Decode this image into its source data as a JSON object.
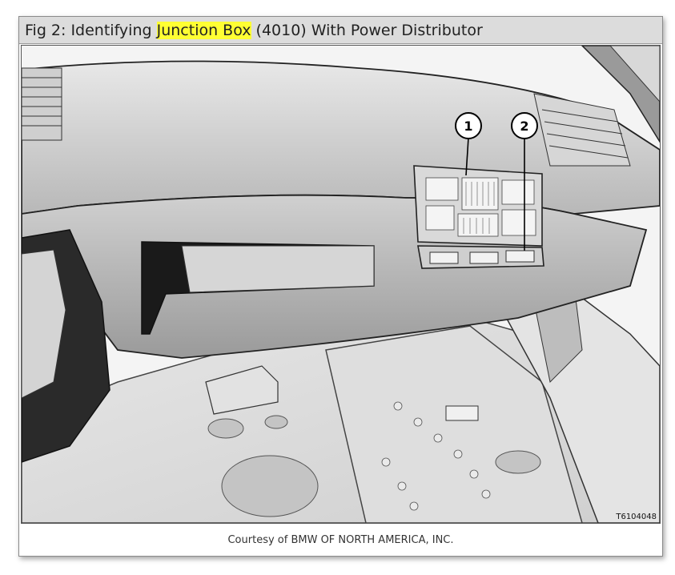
{
  "figure": {
    "title_prefix": "Fig 2: Identifying ",
    "title_highlight": "Junction Box",
    "title_suffix": " (4010) With Power Distributor",
    "callouts": [
      "1",
      "2"
    ],
    "reference_code": "T6104048",
    "caption": "Courtesy of BMW OF NORTH AMERICA, INC."
  },
  "colors": {
    "highlight": "#ffff33",
    "title_bar": "#dcdcdc"
  }
}
